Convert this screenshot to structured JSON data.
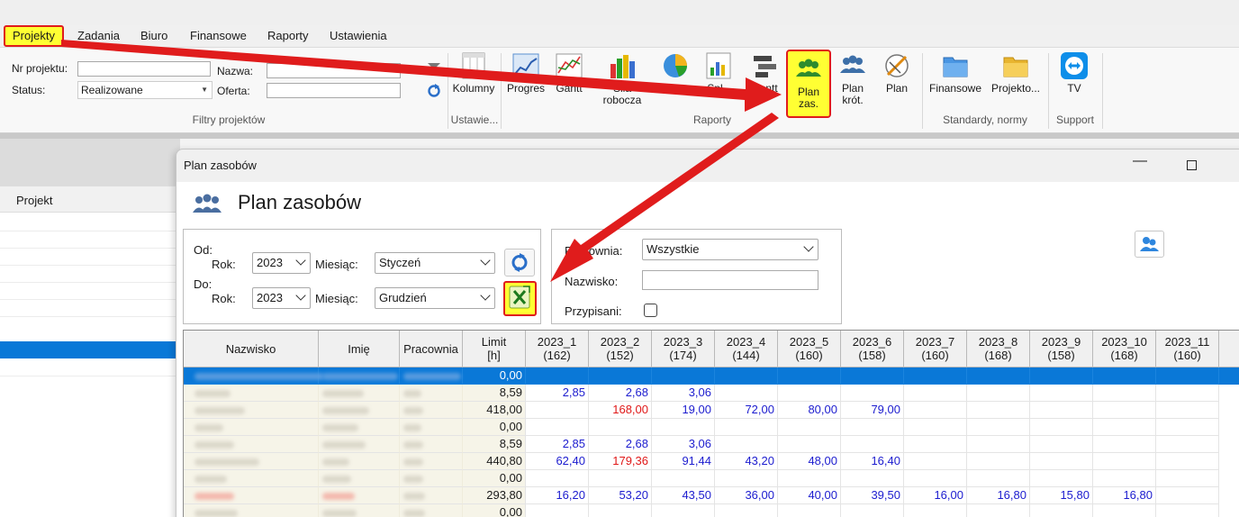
{
  "menu": [
    "Projekty",
    "Zadania",
    "Biuro",
    "Finansowe",
    "Raporty",
    "Ustawienia"
  ],
  "filters": {
    "nr_label": "Nr projektu:",
    "status_label": "Status:",
    "status_value": "Realizowane",
    "nazwa_label": "Nazwa:",
    "oferta_label": "Oferta:",
    "group_label": "Filtry projektów"
  },
  "ribbon": {
    "kolumny": "Kolumny",
    "ustawienia_label": "Ustawie...",
    "progres": "Progres",
    "gantt_small": "Gantt",
    "sila_robocza": "Siła robocza",
    "status": "Status",
    "splata": "Spł...",
    "gantt": "Gantt",
    "plan_zas": "Plan zas.",
    "plan_krot": "Plan krót.",
    "plan": "Plan",
    "raporty_label": "Raporty",
    "finansowe": "Finansowe",
    "projekto": "Projekto...",
    "standardy_label": "Standardy, normy",
    "tv": "TV",
    "support_label": "Support"
  },
  "leftpanel": {
    "header": "Projekt"
  },
  "window": {
    "title": "Plan zasobów",
    "heading": "Plan zasobów",
    "od_label": "Od:",
    "do_label": "Do:",
    "rok_label": "Rok:",
    "miesiac_label": "Miesiąc:",
    "od_rok": "2023",
    "od_miesiac": "Styczeń",
    "do_rok": "2023",
    "do_miesiac": "Grudzień",
    "pracownia_label": "Pracownia:",
    "pracownia_value": "Wszystkie",
    "nazwisko_label": "Nazwisko:",
    "przypisani_label": "Przypisani:"
  },
  "table": {
    "headers": [
      "Nazwisko",
      "Imię",
      "Pracownia",
      "Limit\n[h]",
      "2023_1\n(162)",
      "2023_2\n(152)",
      "2023_3\n(174)",
      "2023_4\n(144)",
      "2023_5\n(160)",
      "2023_6\n(158)",
      "2023_7\n(160)",
      "2023_8\n(168)",
      "2023_9\n(158)",
      "2023_10\n(168)",
      "2023_11\n(160)",
      "20"
    ],
    "rows": [
      {
        "limit": "0,00",
        "m": [
          "",
          "",
          "",
          "",
          "",
          "",
          "",
          "",
          "",
          "",
          ""
        ]
      },
      {
        "limit": "8,59",
        "m": [
          "2,85",
          "2,68",
          "3,06",
          "",
          "",
          "",
          "",
          "",
          "",
          "",
          ""
        ]
      },
      {
        "limit": "418,00",
        "m": [
          "",
          "168,00",
          "19,00",
          "72,00",
          "80,00",
          "79,00",
          "",
          "",
          "",
          "",
          ""
        ]
      },
      {
        "limit": "0,00",
        "m": [
          "",
          "",
          "",
          "",
          "",
          "",
          "",
          "",
          "",
          "",
          ""
        ]
      },
      {
        "limit": "8,59",
        "m": [
          "2,85",
          "2,68",
          "3,06",
          "",
          "",
          "",
          "",
          "",
          "",
          "",
          ""
        ]
      },
      {
        "limit": "440,80",
        "m": [
          "62,40",
          "179,36",
          "91,44",
          "43,20",
          "48,00",
          "16,40",
          "",
          "",
          "",
          "",
          ""
        ]
      },
      {
        "limit": "0,00",
        "m": [
          "",
          "",
          "",
          "",
          "",
          "",
          "",
          "",
          "",
          "",
          ""
        ]
      },
      {
        "limit": "293,80",
        "m": [
          "16,20",
          "53,20",
          "43,50",
          "36,00",
          "40,00",
          "39,50",
          "16,00",
          "16,80",
          "15,80",
          "16,80",
          ""
        ]
      },
      {
        "limit": "0,00",
        "m": [
          "",
          "",
          "",
          "",
          "",
          "",
          "",
          "",
          "",
          "",
          ""
        ]
      }
    ],
    "red_cells": [
      [
        2,
        1
      ],
      [
        5,
        1
      ]
    ]
  },
  "colors": {
    "highlight": "#ffff33",
    "arrow": "#e01c1c",
    "selection": "#0a78d7",
    "value_blue": "#1c1ccf",
    "value_red": "#e01818"
  }
}
